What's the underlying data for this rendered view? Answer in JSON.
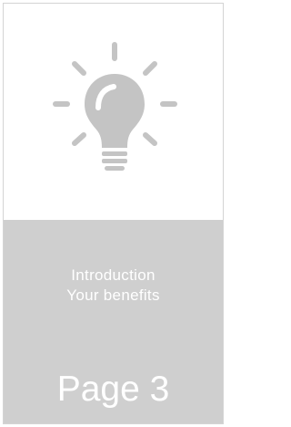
{
  "card": {
    "icon": "lightbulb-icon",
    "icon_color": "#c4c4c4",
    "panel_color": "#cfcfcf",
    "text_color": "#ffffff",
    "subtitle_lines": [
      "Introduction",
      "Your benefits"
    ],
    "page_label": "Page 3"
  }
}
